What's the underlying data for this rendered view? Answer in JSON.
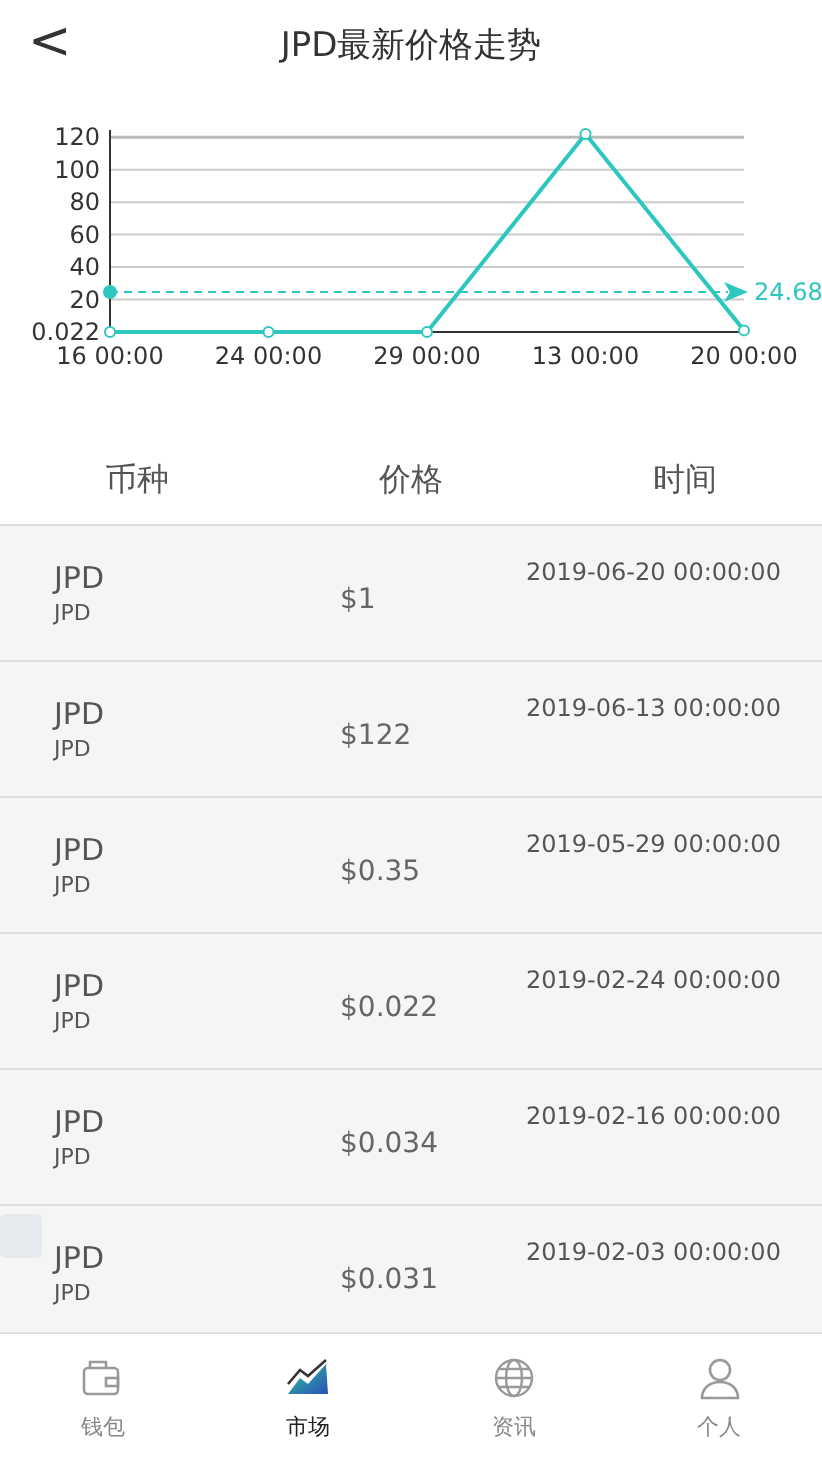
{
  "header": {
    "back": "<",
    "title": "JPD最新价格走势"
  },
  "chart": {
    "chart_data": {
      "type": "line",
      "categories": [
        "16 00:00",
        "24 00:00",
        "29 00:00",
        "13 00:00",
        "20 00:00"
      ],
      "values": [
        0.022,
        0.022,
        0.022,
        122,
        1
      ],
      "marker": "circle",
      "grid": true,
      "ylim": [
        0,
        122
      ],
      "yticks": [
        {
          "value": 0.022,
          "label": "0.022"
        },
        20,
        40,
        60,
        80,
        100,
        120
      ],
      "ref_lines": [
        {
          "axis": "y",
          "value": 24.68,
          "label": "24.68",
          "color": "#2ec7c0"
        }
      ]
    }
  },
  "table": {
    "columns": [
      "币种",
      "价格",
      "时间"
    ],
    "rows": [
      {
        "name": "JPD",
        "symbol": "JPD",
        "price": "$1",
        "time": "2019-06-20 00:00:00"
      },
      {
        "name": "JPD",
        "symbol": "JPD",
        "price": "$122",
        "time": "2019-06-13 00:00:00"
      },
      {
        "name": "JPD",
        "symbol": "JPD",
        "price": "$0.35",
        "time": "2019-05-29 00:00:00"
      },
      {
        "name": "JPD",
        "symbol": "JPD",
        "price": "$0.022",
        "time": "2019-02-24 00:00:00"
      },
      {
        "name": "JPD",
        "symbol": "JPD",
        "price": "$0.034",
        "time": "2019-02-16 00:00:00"
      },
      {
        "name": "JPD",
        "symbol": "JPD",
        "price": "$0.031",
        "time": "2019-02-03 00:00:00"
      }
    ]
  },
  "tabbar": [
    {
      "kind": "wallet",
      "label": "钱包",
      "selected": false
    },
    {
      "kind": "market",
      "label": "市场",
      "selected": true
    },
    {
      "kind": "news",
      "label": "资讯",
      "selected": false
    },
    {
      "kind": "profile",
      "label": "个人",
      "selected": false
    }
  ]
}
